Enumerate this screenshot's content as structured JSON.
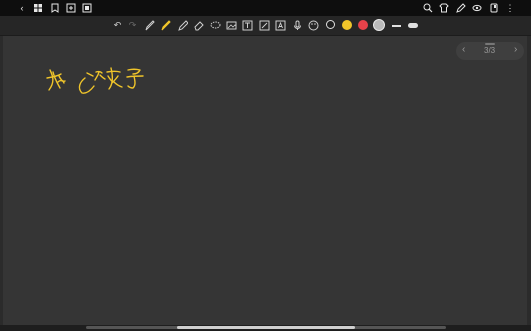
{
  "topbar": {
    "left_icons": [
      "back-arrow-icon",
      "apps-grid-icon",
      "bookmark-icon",
      "add-page-icon",
      "page-layout-icon"
    ],
    "right_icons": [
      "search-icon",
      "shirt-icon",
      "pen-sign-icon",
      "eye-icon",
      "document-icon",
      "more-vert-icon"
    ]
  },
  "toolbar": {
    "tools": [
      "undo-icon",
      "redo-icon",
      "pen-icon",
      "highlighter-icon",
      "pencil-icon",
      "eraser-icon",
      "lasso-icon",
      "image-icon",
      "text-box-icon",
      "shapes-icon",
      "ocr-icon",
      "mic-icon",
      "palette-icon"
    ],
    "colors": [
      "#2a2a2a",
      "#f0c52a",
      "#e8424a",
      "#b9b9b9"
    ],
    "active_color": "#f0c52a"
  },
  "page_nav": {
    "page_indicator": "3/3"
  },
  "handwriting": {
    "ink_color": "#f0c52a",
    "text": "如何求导"
  }
}
